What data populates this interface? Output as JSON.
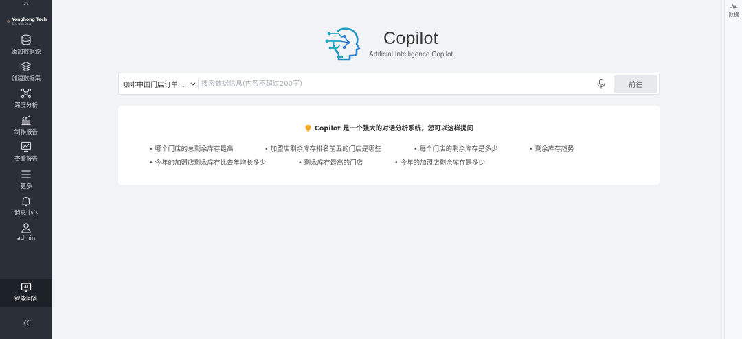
{
  "sidebar": {
    "brand": {
      "name": "Yonghong Tech",
      "slogan": "Talk with Data"
    },
    "items": [
      {
        "label": "添加数据源",
        "icon": "database-icon"
      },
      {
        "label": "创建数据集",
        "icon": "layers-icon"
      },
      {
        "label": "深度分析",
        "icon": "network-icon"
      },
      {
        "label": "制作报告",
        "icon": "bar-chart-icon"
      },
      {
        "label": "查看报告",
        "icon": "monitor-chart-icon"
      },
      {
        "label": "更多",
        "icon": "menu-icon"
      },
      {
        "label": "消息中心",
        "icon": "bell-icon"
      },
      {
        "label": "admin",
        "icon": "user-icon"
      }
    ],
    "active_item": {
      "label": "智能问答",
      "icon": "ai-chat-icon"
    },
    "collapse_icon": "double-chevron-left-icon"
  },
  "right_rail": {
    "label": "数据",
    "icon": "pulse-icon"
  },
  "hero": {
    "title": "Copilot",
    "subtitle": "Artificial Intelligence Copilot"
  },
  "search": {
    "dataset_selected": "咖啡中国门店订单...",
    "placeholder": "搜索数据信息(内容不超过200字)",
    "value": "",
    "go_label": "前往"
  },
  "suggestions": {
    "heading": "Copilot 是一个强大的对话分析系统，您可以这样提问",
    "items": [
      "哪个门店的总剩余库存最高",
      "加盟店剩余库存排名前五的门店是哪些",
      "每个门店的剩余库存是多少",
      "剩余库存趋势",
      "今年的加盟店剩余库存比去年增长多少",
      "剩余库存最高的门店",
      "今年的加盟店剩余库存是多少"
    ]
  },
  "colors": {
    "sidebar_bg": "#2b3038",
    "brand_teal": "#1aa7b8",
    "brand_blue": "#2f7fd8",
    "bulb_orange": "#f5a623"
  }
}
